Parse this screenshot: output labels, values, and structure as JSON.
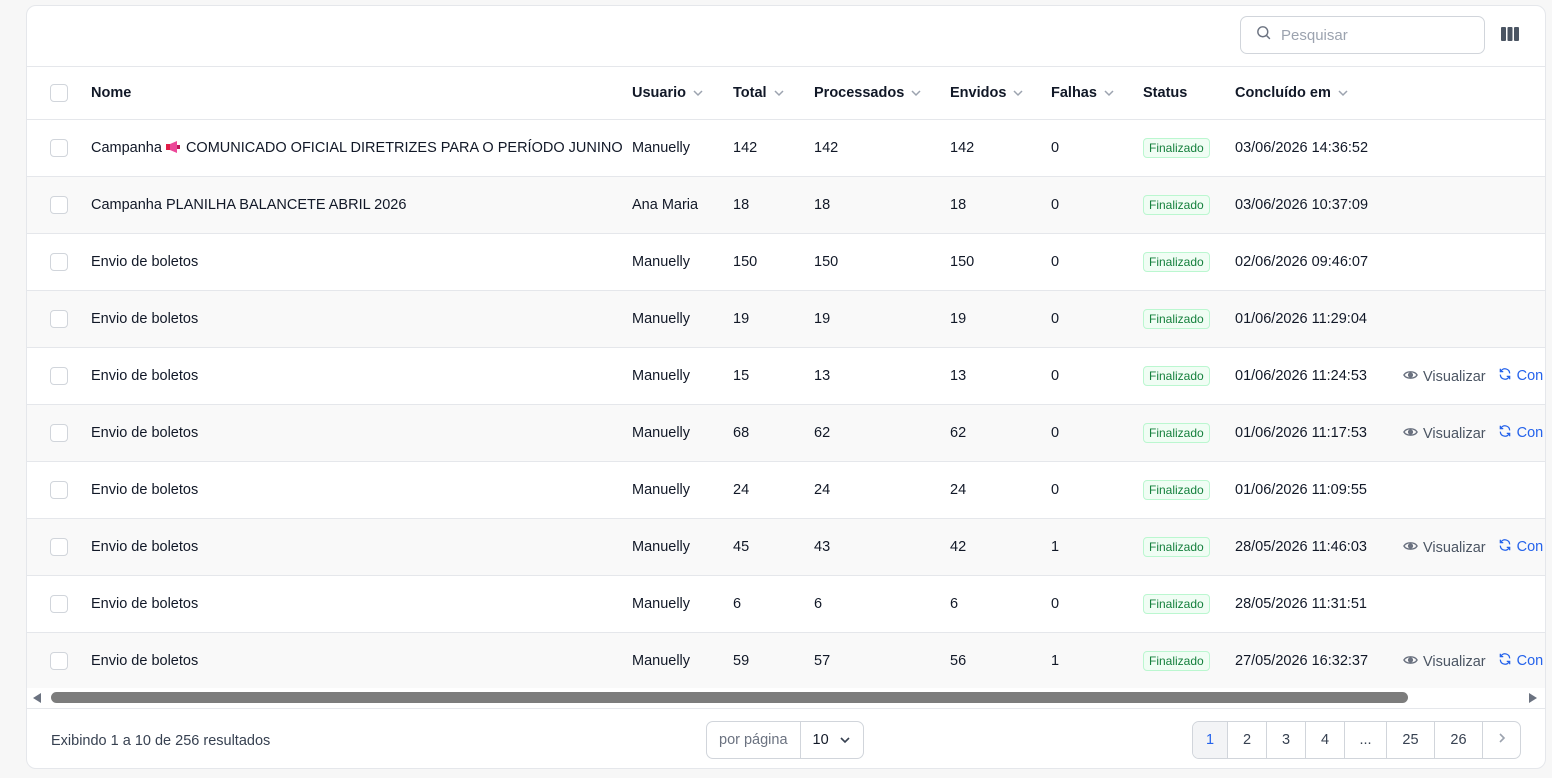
{
  "search": {
    "placeholder": "Pesquisar"
  },
  "columns": {
    "nome": "Nome",
    "usuario": "Usuario",
    "total": "Total",
    "processados": "Processados",
    "envidos": "Envidos",
    "falhas": "Falhas",
    "status": "Status",
    "concluido": "Concluído em"
  },
  "rows": [
    {
      "nome_prefix": "Campanha",
      "nome_icon": "loudspeaker-emoji",
      "nome": "COMUNICADO OFICIAL DIRETRIZES PARA O PERÍODO JUNINO",
      "usuario": "Manuelly",
      "total": "142",
      "processados": "142",
      "envidos": "142",
      "falhas": "0",
      "status": "Finalizado",
      "concluido": "03/06/2026 14:36:52",
      "actions": false
    },
    {
      "nome_prefix": "",
      "nome": "Campanha PLANILHA BALANCETE ABRIL 2026",
      "usuario": "Ana Maria",
      "total": "18",
      "processados": "18",
      "envidos": "18",
      "falhas": "0",
      "status": "Finalizado",
      "concluido": "03/06/2026 10:37:09",
      "actions": false
    },
    {
      "nome_prefix": "",
      "nome": "Envio de boletos",
      "usuario": "Manuelly",
      "total": "150",
      "processados": "150",
      "envidos": "150",
      "falhas": "0",
      "status": "Finalizado",
      "concluido": "02/06/2026 09:46:07",
      "actions": false
    },
    {
      "nome_prefix": "",
      "nome": "Envio de boletos",
      "usuario": "Manuelly",
      "total": "19",
      "processados": "19",
      "envidos": "19",
      "falhas": "0",
      "status": "Finalizado",
      "concluido": "01/06/2026 11:29:04",
      "actions": false
    },
    {
      "nome_prefix": "",
      "nome": "Envio de boletos",
      "usuario": "Manuelly",
      "total": "15",
      "processados": "13",
      "envidos": "13",
      "falhas": "0",
      "status": "Finalizado",
      "concluido": "01/06/2026 11:24:53",
      "actions": true
    },
    {
      "nome_prefix": "",
      "nome": "Envio de boletos",
      "usuario": "Manuelly",
      "total": "68",
      "processados": "62",
      "envidos": "62",
      "falhas": "0",
      "status": "Finalizado",
      "concluido": "01/06/2026 11:17:53",
      "actions": true
    },
    {
      "nome_prefix": "",
      "nome": "Envio de boletos",
      "usuario": "Manuelly",
      "total": "24",
      "processados": "24",
      "envidos": "24",
      "falhas": "0",
      "status": "Finalizado",
      "concluido": "01/06/2026 11:09:55",
      "actions": false
    },
    {
      "nome_prefix": "",
      "nome": "Envio de boletos",
      "usuario": "Manuelly",
      "total": "45",
      "processados": "43",
      "envidos": "42",
      "falhas": "1",
      "status": "Finalizado",
      "concluido": "28/05/2026 11:46:03",
      "actions": true
    },
    {
      "nome_prefix": "",
      "nome": "Envio de boletos",
      "usuario": "Manuelly",
      "total": "6",
      "processados": "6",
      "envidos": "6",
      "falhas": "0",
      "status": "Finalizado",
      "concluido": "28/05/2026 11:31:51",
      "actions": false
    },
    {
      "nome_prefix": "",
      "nome": "Envio de boletos",
      "usuario": "Manuelly",
      "total": "59",
      "processados": "57",
      "envidos": "56",
      "falhas": "1",
      "status": "Finalizado",
      "concluido": "27/05/2026 16:32:37",
      "actions": true
    }
  ],
  "row_actions": {
    "view_label": "Visualizar",
    "continue_label": "Con"
  },
  "footer": {
    "summary": "Exibindo 1 a 10 de 256 resultados",
    "per_page_label": "por página",
    "per_page_value": "10",
    "pages": [
      "1",
      "2",
      "3",
      "4",
      "...",
      "25",
      "26"
    ],
    "active_page": "1"
  },
  "colors": {
    "accent": "#2563eb",
    "status_green": "#15803d",
    "status_bg": "#f0fdf4"
  }
}
